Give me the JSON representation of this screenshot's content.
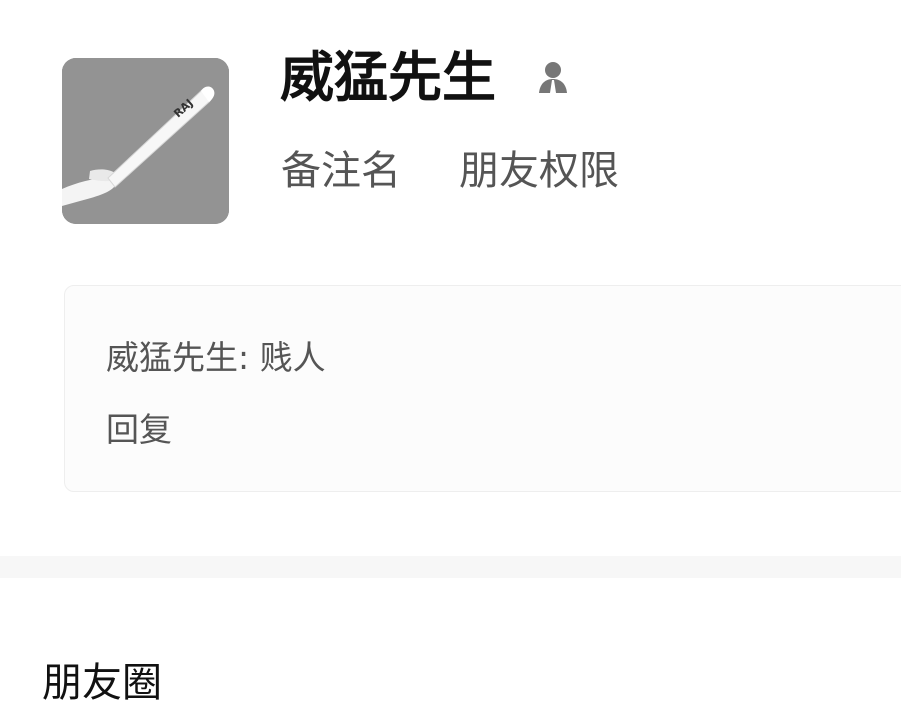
{
  "profile": {
    "name": "威猛先生",
    "icons": {
      "avatar": "baseball-bat-photo",
      "contact": "person-icon"
    }
  },
  "actions": {
    "remark_label": "备注名",
    "permissions_label": "朋友权限"
  },
  "message": {
    "text": "威猛先生: 贱人",
    "reply_label": "回复"
  },
  "moments": {
    "title": "朋友圈"
  },
  "colors": {
    "background": "#ffffff",
    "card": "#fcfcfc",
    "section_gap": "#f7f7f7",
    "primary_text": "#111111",
    "secondary_text": "#555555"
  }
}
